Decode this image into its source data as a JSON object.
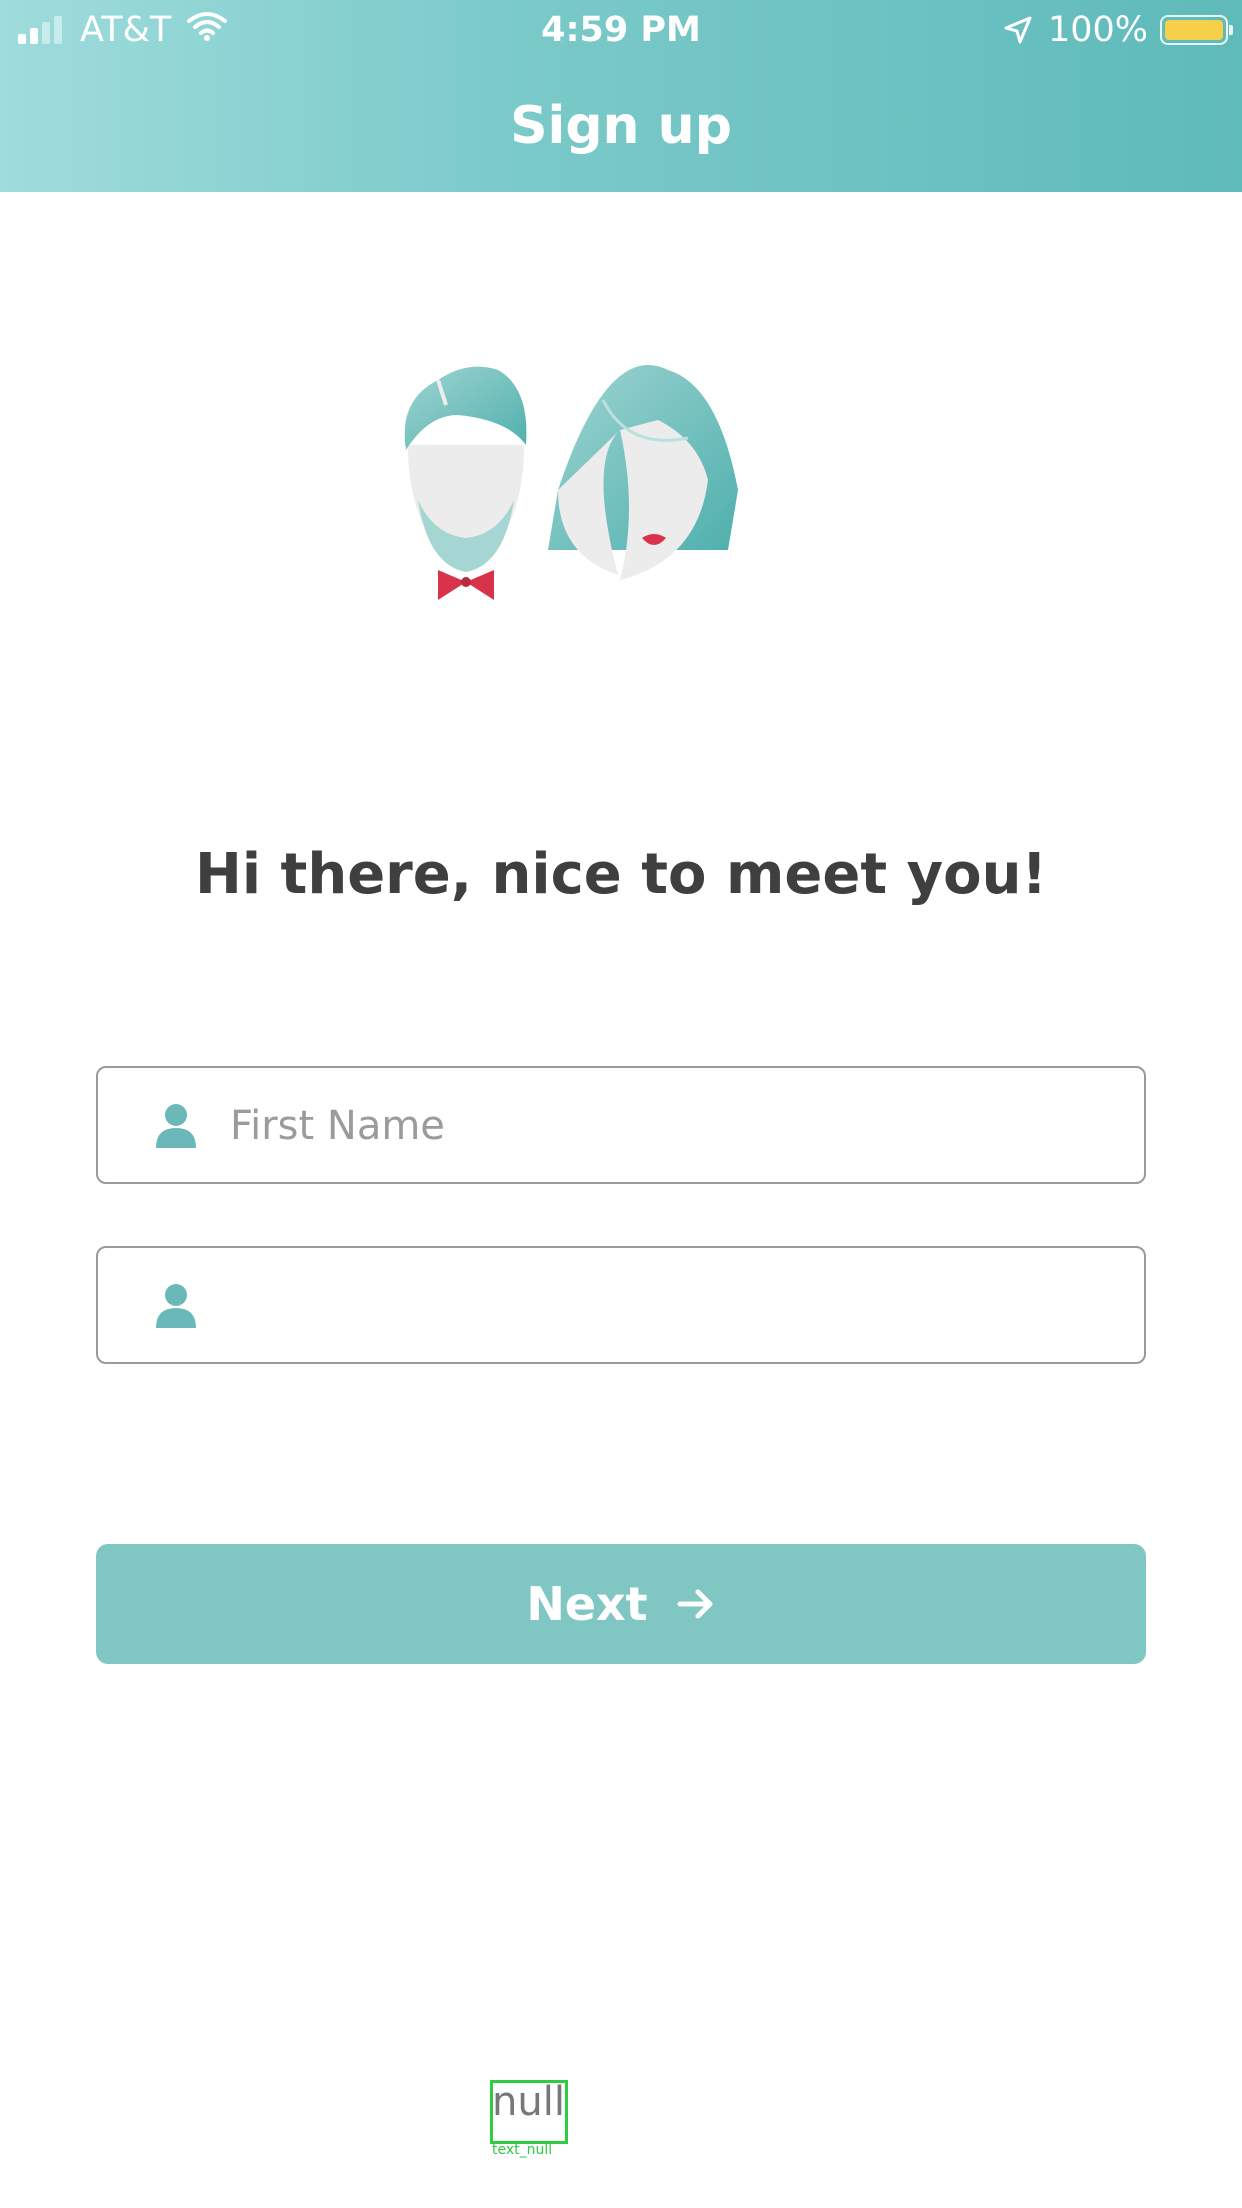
{
  "status_bar": {
    "carrier": "AT&T",
    "time": "4:59 PM",
    "battery": "100%",
    "battery_level": 1.0
  },
  "header": {
    "title": "Sign up"
  },
  "greeting": "Hi there, nice to meet you!",
  "fields": {
    "first_name": {
      "placeholder": "First Name",
      "value": ""
    },
    "last_name": {
      "placeholder": "",
      "value": ""
    }
  },
  "next_button": {
    "label": "Next"
  },
  "bottom_overlay": {
    "text": "null",
    "tag": "text_null"
  },
  "colors": {
    "header_start": "#9fdcdc",
    "header_end": "#5fbaba",
    "accent": "#80c7c3",
    "icon": "#6bb8b8",
    "bow_lips": "#d8334a",
    "battery": "#f5d04a"
  },
  "icons": [
    "signal-icon",
    "wifi-icon",
    "location-arrow-icon",
    "battery-icon",
    "person-icon",
    "arrow-right-icon"
  ]
}
